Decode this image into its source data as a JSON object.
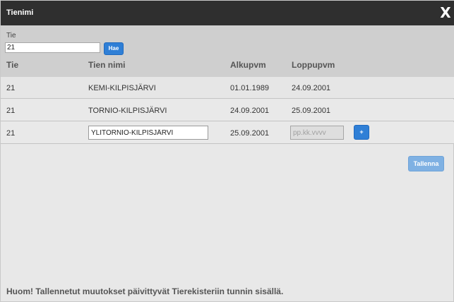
{
  "window": {
    "title": "Tienimi",
    "close_label": "X"
  },
  "search": {
    "label": "Tie",
    "value": "21",
    "button_label": "Hae"
  },
  "table": {
    "headers": [
      "Tie",
      "Tien nimi",
      "Alkupvm",
      "Loppupvm"
    ],
    "rows": [
      {
        "tie": "21",
        "name": "KEMI-KILPISJÄRVI",
        "start": "01.01.1989",
        "end": "24.09.2001"
      },
      {
        "tie": "21",
        "name": "TORNIO-KILPISJÄRVI",
        "start": "24.09.2001",
        "end": "25.09.2001"
      }
    ],
    "edit_row": {
      "tie": "21",
      "name_value": "YLITORNIO-KILPISJÄRVI",
      "start": "25.09.2001",
      "end_placeholder": "pp.kk.vvvv",
      "add_label": "+"
    }
  },
  "actions": {
    "save_label": "Tallenna"
  },
  "note": "Huom! Tallennetut muutokset päivittyvät Tierekisteriin tunnin sisällä."
}
